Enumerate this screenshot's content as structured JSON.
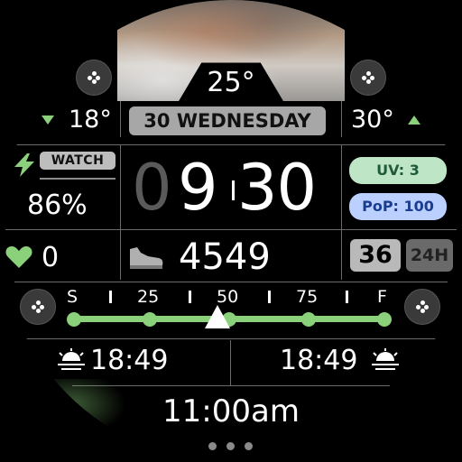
{
  "weather": {
    "current_temp": "25°",
    "low_temp": "18°",
    "high_temp": "30°",
    "uv_label": "UV: 3",
    "pop_label": "PoP: 100"
  },
  "date": {
    "label": "30 WEDNESDAY"
  },
  "time": {
    "hour_dim": "0",
    "hour": "9",
    "separator": "I",
    "minutes": "30"
  },
  "battery": {
    "badge": "WATCH",
    "percent": "86%"
  },
  "heart": {
    "value": "0"
  },
  "steps": {
    "value": "4549"
  },
  "week": {
    "number": "36",
    "format_badge": "24H"
  },
  "progress": {
    "scale_labels": [
      "S",
      "25",
      "50",
      "75",
      "F"
    ],
    "value_fraction": 0.46
  },
  "sun": {
    "sunrise": "18:49",
    "sunset": "18:49"
  },
  "alarm": {
    "label": "11:00am"
  },
  "colors": {
    "accent_green": "#8bd07a",
    "pill_gray": "#a7a7a7",
    "uv_bg": "#bfe5c7",
    "pop_bg": "#bcd0ff"
  },
  "icons": {
    "top_left": "apps-grid-icon",
    "top_right": "apps-grid-icon",
    "mid_left": "apps-grid-icon",
    "mid_right": "apps-grid-icon",
    "battery": "lightning-icon",
    "heart": "heart-icon",
    "steps": "shoe-icon",
    "sunrise": "sunrise-icon",
    "sunset": "sunset-icon"
  }
}
